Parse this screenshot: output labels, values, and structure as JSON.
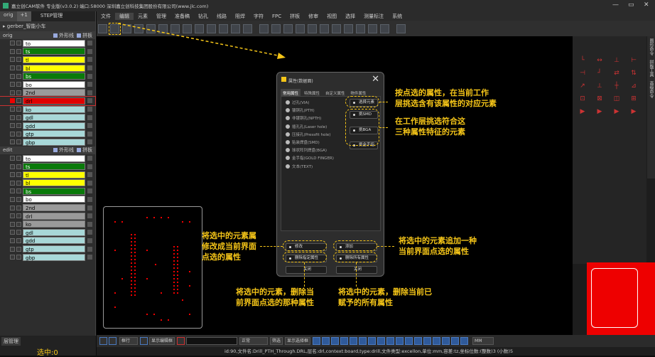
{
  "titlebar": {
    "title": "嘉立创CAM软件 专业版(v3.0.2) 端口:58000      深圳嘉立创科技集团股份有限公司(www.jlc.com)",
    "controls": [
      "—",
      "▭",
      "✕"
    ]
  },
  "left": {
    "tabs": [
      "orig",
      "+1",
      "STEP管理"
    ],
    "gerber": "gerber_智能小车",
    "groups": [
      {
        "name": "orig",
        "outline_label": "外形线",
        "board_label": "拼板",
        "layers": [
          {
            "name": "to",
            "color": "#ffffff"
          },
          {
            "name": "ts",
            "color": "#0a7a0a"
          },
          {
            "name": "tl",
            "color": "#ffff00"
          },
          {
            "name": "bl",
            "color": "#ffff00"
          },
          {
            "name": "bs",
            "color": "#0a7a0a"
          },
          {
            "name": "bo",
            "color": "#ffffff"
          },
          {
            "name": "2nd",
            "color": "#9a9a9a"
          },
          {
            "name": "drl",
            "color": "#e00000"
          },
          {
            "name": "ko",
            "color": "#a8d8d8"
          },
          {
            "name": "gdl",
            "color": "#a8d8d8"
          },
          {
            "name": "gdd",
            "color": "#a8d8d8"
          },
          {
            "name": "gtp",
            "color": "#a8d8d8"
          },
          {
            "name": "gbp",
            "color": "#a8d8d8"
          }
        ]
      },
      {
        "name": "edit",
        "outline_label": "外形线",
        "board_label": "拼板",
        "layers": [
          {
            "name": "to",
            "color": "#ffffff"
          },
          {
            "name": "ts",
            "color": "#0a7a0a"
          },
          {
            "name": "tl",
            "color": "#ffff00"
          },
          {
            "name": "bl",
            "color": "#ffff00"
          },
          {
            "name": "bs",
            "color": "#0a7a0a"
          },
          {
            "name": "bo",
            "color": "#ffffff"
          },
          {
            "name": "2nd",
            "color": "#9a9a9a"
          },
          {
            "name": "drl",
            "color": "#9a9a9a"
          },
          {
            "name": "ko",
            "color": "#9a9a9a"
          },
          {
            "name": "gdl",
            "color": "#a8d8d8"
          },
          {
            "name": "gdd",
            "color": "#a8d8d8"
          },
          {
            "name": "gtp",
            "color": "#a8d8d8"
          },
          {
            "name": "gbp",
            "color": "#a8d8d8"
          }
        ]
      }
    ],
    "layer_manager": "层管理",
    "selected_count": "选中:0"
  },
  "menubar": [
    "文件",
    "编辑",
    "元素",
    "管理",
    "准备稿",
    "钻孔",
    "线路",
    "阻焊",
    "字符",
    "FPC",
    "拼板",
    "修审",
    "视图",
    "选择",
    "测量标注",
    "系统"
  ],
  "menubar_active": "编辑",
  "dialog": {
    "title": "属性(数据面)",
    "close": "✕",
    "tabs": [
      "常用属性",
      "特殊属性",
      "自定义属性",
      "物件属性"
    ],
    "options": [
      "过孔(VIA)",
      "镀铜孔(PTH)",
      "非镀铜孔(NPTH)",
      "插孔孔(Laser hole)",
      "压接孔(Pressfit hole)",
      "贴装焊盘(SMD)",
      "球状阵列焊盘(BGA)",
      "金手指(GOLD FINGER)",
      "文本(TEXT)"
    ],
    "select_button": "选择元素",
    "sel_smd": "挑SMD",
    "sel_bga": "挑BGA",
    "sel_gold": "挑金手指",
    "modify": "修改",
    "add": "添加",
    "delete_specified": "删除指定属性",
    "delete_all": "删除所有属性",
    "close_left": "关闭",
    "close_right": "关闭"
  },
  "notes": {
    "select_by_attr": [
      "按点选的属性，在当前工作",
      "层挑选含有该属性的对应元素"
    ],
    "pick_three": [
      "在工作层挑选符合这",
      "三种属性特征的元素"
    ],
    "modify": [
      "将选中的元素属",
      "修改成当前界面",
      "点选的属性"
    ],
    "add": [
      "将选中的元素追加一种",
      "当前界面点选的属性"
    ],
    "delete_specified": [
      "将选中的元素，删除当",
      "前界面点选的那种属性"
    ],
    "delete_all": [
      "将选中的元素，删除当前已",
      "赋予的所有属性"
    ]
  },
  "right_tabs": [
    "图形命令",
    "拼板工具",
    "高级命令"
  ],
  "bottombar": {
    "mode": "框行",
    "display_box": "显示编辑框",
    "state": "正常",
    "filter": "筛选",
    "display_select": "显示选择框",
    "unit": "MM"
  },
  "status": "id:90,文件名:Drill_PTH_Through.DRL,层名:drl,context:board,type:drill,文件类型:excellon,单位:mm,容差:tz,坐标位数:(整数)3 (小数)5",
  "colors": {
    "accent": "#f5c518",
    "pad": "#e00000"
  }
}
